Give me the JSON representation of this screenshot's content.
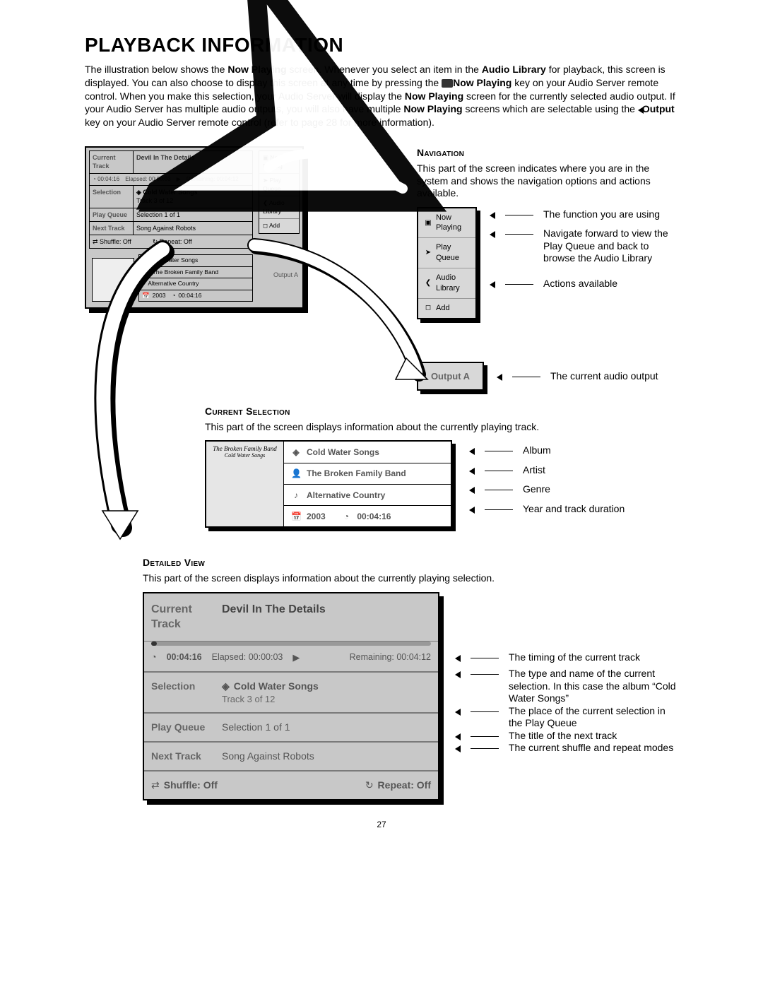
{
  "page_number": "27",
  "title": "PLAYBACK INFORMATION",
  "intro": {
    "p1_a": "The illustration below shows the ",
    "p1_b_bold": "Now Playing",
    "p1_c": " screen.  Whenever you select an item in the ",
    "p1_d_bold": "Audio Library",
    "p1_e": " for playback, this screen is displayed.  You can also choose to display this screen at any time by pressing the ",
    "p1_f_bold": "Now Playing",
    "p1_g": " key on your Audio Server remote control.  When you make this selection, your Audio Server will display the ",
    "p1_h_bold": "Now Playing",
    "p1_i": " screen for the currently selected audio output.  If your Audio Server has multiple audio outputs, you will also have multiple ",
    "p1_j_bold": "Now Playing",
    "p1_k": " screens which are selectable using the ",
    "p1_l_bold": "Output",
    "p1_m": " key on your Audio Server remote control (refer to page 28 for more information)."
  },
  "navigation": {
    "heading": "Navigation",
    "desc": "This part of the screen indicates where you are in the system and shows the navigation options and actions available.",
    "items": [
      {
        "glyph": "▣",
        "label_a": "Now",
        "label_b": "Playing"
      },
      {
        "glyph": "➤",
        "label_a": "Play",
        "label_b": "Queue"
      },
      {
        "glyph": "❮",
        "label_a": "Audio",
        "label_b": "Library"
      },
      {
        "glyph": "◻",
        "label_a": "Add",
        "label_b": ""
      }
    ],
    "ann": [
      "The function you are using",
      "Navigate forward to view the Play Queue and back to browse the Audio Library",
      "Actions available"
    ],
    "output_label": "Output A",
    "output_ann": "The current audio output"
  },
  "mini": {
    "row_current_label": "Current Track",
    "row_current_value": "Devil In The Details",
    "timing_total": "00:04:16",
    "timing_elapsed": "Elapsed: 00:00:03",
    "timing_remaining": "Remaining: 00:04:12",
    "selection_label": "Selection",
    "selection_value_a": "Cold Water Songs",
    "selection_value_b": "Track 3 of 12",
    "playqueue_label": "Play Queue",
    "playqueue_value": "Selection 1 of 1",
    "next_label": "Next Track",
    "next_value": "Song Against Robots",
    "shuffle": "Shuffle: Off",
    "repeat": "Repeat: Off",
    "output": "Output A",
    "detail_album": "Cold Water Songs",
    "detail_artist": "The Broken Family Band",
    "detail_genre": "Alternative Country",
    "detail_year": "2003",
    "detail_duration": "00:04:16"
  },
  "selection": {
    "heading": "Current Selection",
    "desc": "This part of the screen displays information about the currently playing track.",
    "thumb_title": "The Broken Family Band",
    "thumb_sub": "Cold Water Songs",
    "rows": {
      "album": "Cold Water Songs",
      "artist": "The Broken Family Band",
      "genre": "Alternative Country",
      "year": "2003",
      "duration": "00:04:16"
    },
    "ann": [
      "Album",
      "Artist",
      "Genre",
      "Year and track duration"
    ]
  },
  "detailed": {
    "heading": "Detailed View",
    "desc": "This part of the screen displays information about the currently playing selection.",
    "current_label": "Current Track",
    "current_value": "Devil In The Details",
    "time_total": "00:04:16",
    "time_elapsed": "Elapsed: 00:00:03",
    "time_remaining": "Remaining: 00:04:12",
    "selection_label": "Selection",
    "selection_value": "Cold Water Songs",
    "selection_sub": "Track 3 of 12",
    "playq_label": "Play Queue",
    "playq_value": "Selection 1 of 1",
    "next_label": "Next Track",
    "next_value": "Song Against Robots",
    "shuffle": "Shuffle: Off",
    "repeat": "Repeat: Off",
    "ann": [
      "The timing of the current track",
      "The type and name of the current selection. In this case the album “Cold Water Songs”",
      "The place of the current selection in the Play Queue",
      "The title of the next track",
      "The current shuffle and repeat modes"
    ]
  }
}
